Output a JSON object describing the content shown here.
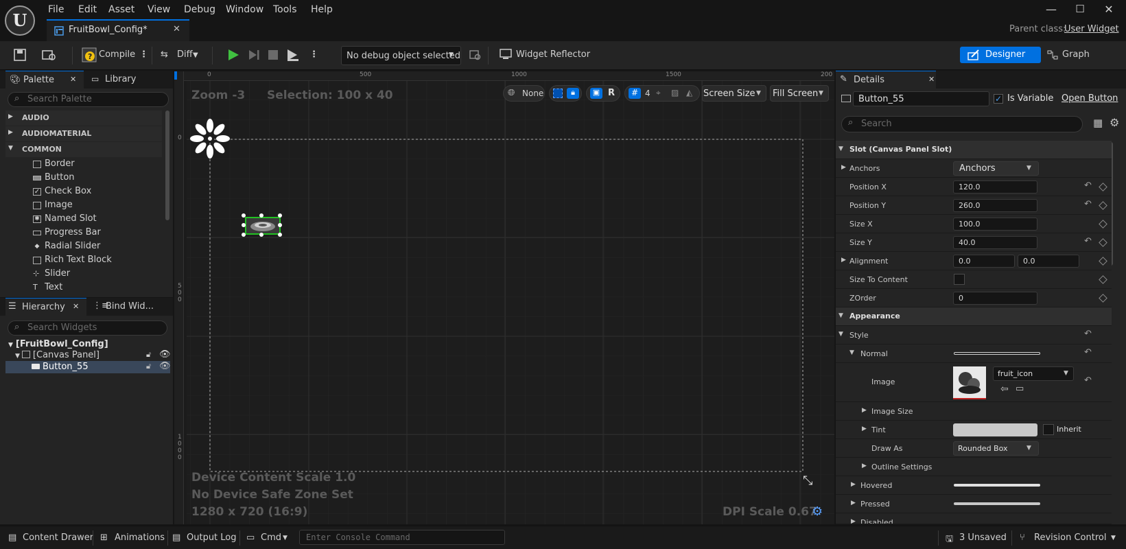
{
  "menu": [
    "File",
    "Edit",
    "Asset",
    "View",
    "Debug",
    "Window",
    "Tools",
    "Help"
  ],
  "document_tab": {
    "title": "FruitBowl_Config*"
  },
  "parent_class": {
    "label": "Parent class:",
    "value": "User Widget"
  },
  "toolbar": {
    "compile": "Compile",
    "diff": "Diff",
    "debug_object": "No debug object selected",
    "widget_reflector": "Widget Reflector",
    "designer": "Designer",
    "graph": "Graph"
  },
  "palette": {
    "tab": "Palette",
    "library_tab": "Library",
    "search_placeholder": "Search Palette",
    "categories": [
      "AUDIO",
      "AUDIOMATERIAL",
      "COMMON"
    ],
    "items": [
      "Border",
      "Button",
      "Check Box",
      "Image",
      "Named Slot",
      "Progress Bar",
      "Radial Slider",
      "Rich Text Block",
      "Slider",
      "Text"
    ]
  },
  "hierarchy": {
    "tab": "Hierarchy",
    "bind_tab": "Bind Wid...",
    "search_placeholder": "Search Widgets",
    "nodes": [
      "[FruitBowl_Config]",
      "[Canvas Panel]",
      "Button_55"
    ]
  },
  "canvas": {
    "zoom": "Zoom -3",
    "selection": "Selection: 100 x 40",
    "ruler_top": [
      "0",
      "500",
      "1000",
      "1500",
      "200"
    ],
    "ruler_left": [
      "0",
      "5\n0\n0",
      "1\n0\n0\n0"
    ],
    "toolbar": {
      "locale": "None",
      "r": "R",
      "grid": "4",
      "screen_size": "Screen Size",
      "fill_screen": "Fill Screen"
    },
    "info_lines": [
      "Device Content Scale 1.0",
      "No Device Safe Zone Set",
      "1280 x 720 (16:9)"
    ],
    "dpi": "DPI Scale 0.67"
  },
  "details": {
    "tab": "Details",
    "widget_name": "Button_55",
    "is_variable": "Is Variable",
    "open_button": "Open Button",
    "search_placeholder": "Search",
    "slot_section": "Slot (Canvas Panel Slot)",
    "anchors": {
      "label": "Anchors",
      "value": "Anchors"
    },
    "position_x": {
      "label": "Position X",
      "value": "120.0"
    },
    "position_y": {
      "label": "Position Y",
      "value": "260.0"
    },
    "size_x": {
      "label": "Size X",
      "value": "100.0"
    },
    "size_y": {
      "label": "Size Y",
      "value": "40.0"
    },
    "alignment": {
      "label": "Alignment",
      "x": "0.0",
      "y": "0.0"
    },
    "size_to_content": {
      "label": "Size To Content"
    },
    "zorder": {
      "label": "ZOrder",
      "value": "0"
    },
    "appearance": "Appearance",
    "style": "Style",
    "normal": "Normal",
    "image": {
      "label": "Image",
      "value": "fruit_icon"
    },
    "image_size": "Image Size",
    "tint": {
      "label": "Tint",
      "inherit": "Inherit"
    },
    "draw_as": {
      "label": "Draw As",
      "value": "Rounded Box"
    },
    "outline": "Outline Settings",
    "hovered": "Hovered",
    "pressed": "Pressed",
    "disabled": "Disabled"
  },
  "status_bar": {
    "content_drawer": "Content Drawer",
    "animations": "Animations",
    "output_log": "Output Log",
    "cmd": "Cmd",
    "console_placeholder": "Enter Console Command",
    "unsaved": "3 Unsaved",
    "revision": "Revision Control"
  },
  "colors": {
    "accent": "#0070e0",
    "selection_green": "#22c222",
    "panel": "#242424"
  }
}
